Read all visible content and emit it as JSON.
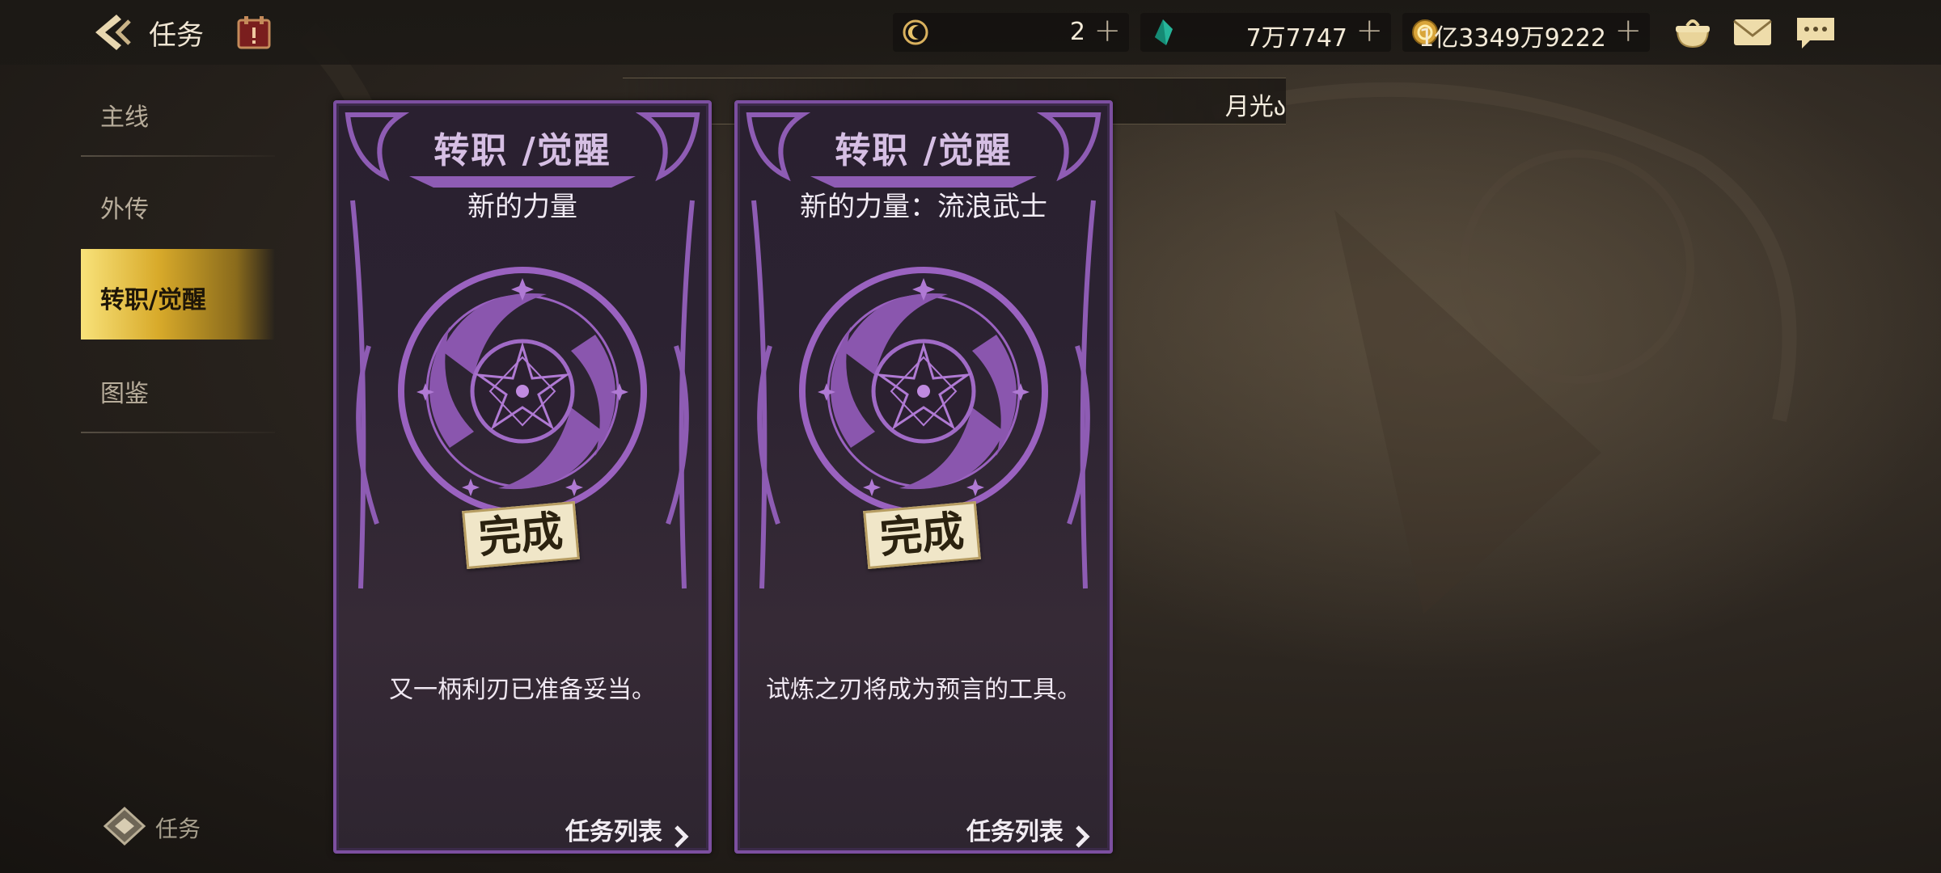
{
  "header": {
    "title": "任务",
    "back_icon": "back-arrow-icon",
    "calendar_icon": "calendar-icon"
  },
  "resources": [
    {
      "icon": "moon-token-icon",
      "value": "2"
    },
    {
      "icon": "green-crystal-icon",
      "value": "7万7747"
    },
    {
      "icon": "gold-coin-icon",
      "value": "1亿3349万9222"
    }
  ],
  "top_icons": [
    "pouch-icon",
    "mail-icon",
    "chat-icon"
  ],
  "sidebar": {
    "items": [
      {
        "label": "主线",
        "active": false
      },
      {
        "label": "外传",
        "active": false
      },
      {
        "label": "转职/觉醒",
        "active": true
      },
      {
        "label": "图鉴",
        "active": false
      }
    ],
    "bottom_label": "任务"
  },
  "banner": {
    "text": "月光ა"
  },
  "cards": [
    {
      "type": "转职 /觉醒",
      "name": "新的力量",
      "stamp": "完成",
      "desc": "又一柄利刃已准备妥当。",
      "list_label": "任务列表"
    },
    {
      "type": "转职 /觉醒",
      "name": "新的力量：流浪武士",
      "stamp": "完成",
      "desc": "试炼之刃将成为预言的工具。",
      "list_label": "任务列表"
    }
  ],
  "colors": {
    "card_border": "#7c4fa0",
    "active_tab": "#d8aa2a",
    "emblem": "#9a62c0"
  }
}
